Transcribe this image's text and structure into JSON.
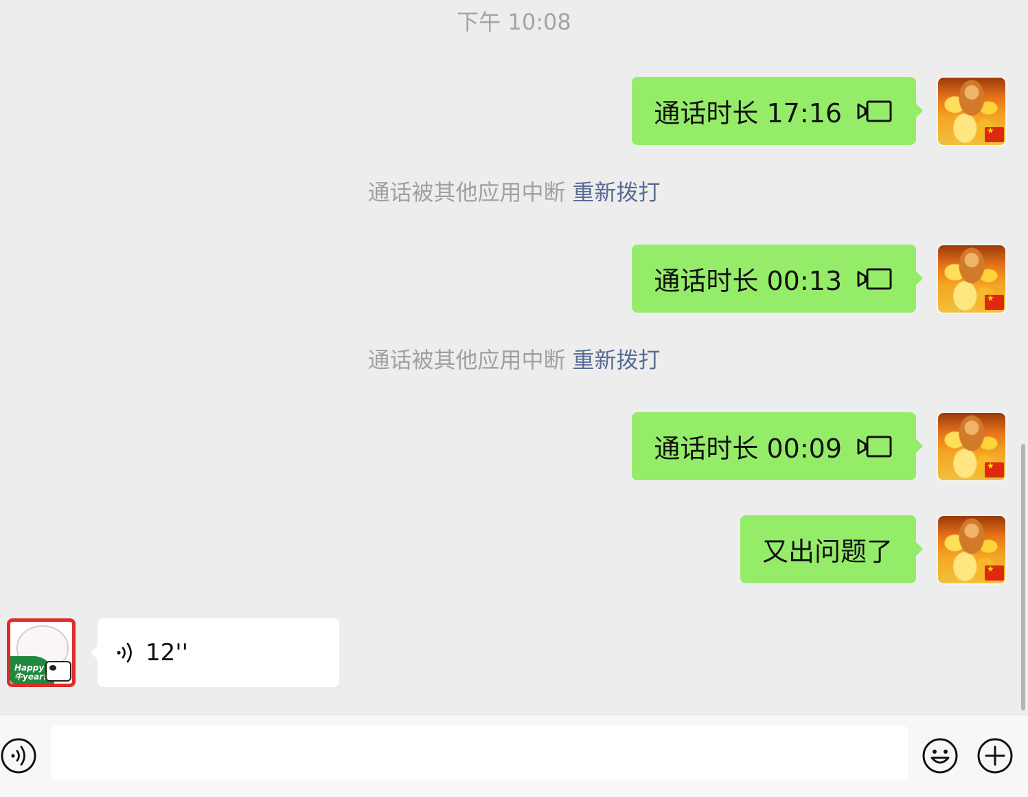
{
  "timestamp": "下午 10:08",
  "messages_me": [
    {
      "text": "通话时长 17:16",
      "icon": "video-call-icon"
    },
    {
      "text": "通话时长 00:13",
      "icon": "video-call-icon"
    },
    {
      "text": "通话时长 00:09",
      "icon": "video-call-icon"
    },
    {
      "text": "又出问题了"
    }
  ],
  "system_messages": [
    {
      "text": "通话被其他应用中断",
      "action": "重新拨打"
    },
    {
      "text": "通话被其他应用中断",
      "action": "重新拨打"
    }
  ],
  "message_them": {
    "duration": "12''",
    "icon": "voice-wave-icon"
  },
  "avatar_them": {
    "caption_line1": "Happy",
    "caption_line2": "牛year!"
  },
  "input_bar": {
    "placeholder": "",
    "left_icon": "voice-input-icon",
    "right_icons": [
      "emoji-icon",
      "plus-icon"
    ]
  },
  "colors": {
    "bubble_me": "#95ec69",
    "bubble_them": "#ffffff",
    "background": "#ededed",
    "link": "#576b95"
  }
}
